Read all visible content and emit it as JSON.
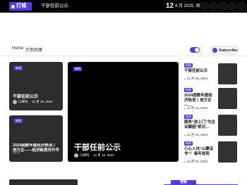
{
  "header": {
    "logo_text": "打城",
    "ticker": "干部任前公示",
    "date_day": "12",
    "date_rest": "8 月 2025, 周二"
  },
  "nav": {
    "home": "Home",
    "sample": "示例页面",
    "subscribe": "Subscribe"
  },
  "cards": [
    {
      "badge": "新闻",
      "title": "干部任前公示",
      "author": "口碑吗",
      "date": "12 月 16, 2024"
    },
    {
      "badge": "新闻",
      "title": "2024函数年度经济热词丨进万企——经济新质并升华航的…",
      "author": "",
      "date": ""
    },
    {
      "badge": "新闻",
      "title": "干部任前公示",
      "author": "口碑吗",
      "date": "12 月 16, 2024"
    }
  ],
  "list": [
    {
      "badge": "新闻",
      "title": "干部任前公示",
      "date": "12 月 16, 2024"
    },
    {
      "badge": "新闻",
      "title": "2024函数年度经济热词丨进万企—…",
      "date": "12 月 16, 2024"
    },
    {
      "badge": "新闻",
      "title": "服务“送上门”为企业解困“抓对…",
      "date": "12 月 16, 2024"
    },
    {
      "badge": "新闻",
      "title": "小心入坑“山寨证书”！每年收到",
      "date": "12 月 16, 2024"
    }
  ],
  "bottom": {
    "tab": "搜索"
  }
}
